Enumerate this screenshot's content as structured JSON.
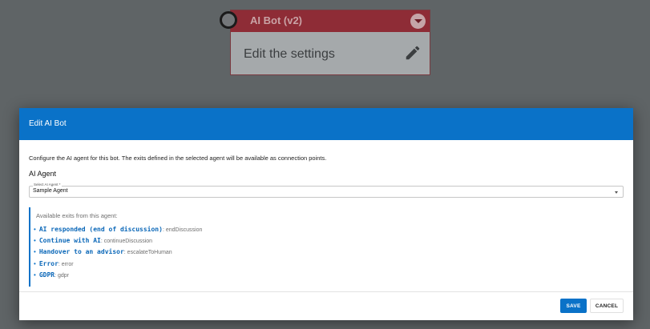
{
  "node": {
    "title": "AI Bot (v2)",
    "body": "Edit the settings",
    "icons": [
      "chevron-down-icon",
      "pencil-icon"
    ]
  },
  "dialog": {
    "title": "Edit AI Bot",
    "description": "Configure the AI agent for this bot. The exits defined in the selected agent will be available as connection points.",
    "agent_heading": "AI Agent",
    "select": {
      "label": "Select AI Agent *",
      "value": "Sample Agent"
    },
    "exits_intro": "Available exits from this agent:",
    "exits": [
      {
        "name": "AI responded (end of discussion)",
        "id": ": endDiscussion"
      },
      {
        "name": "Continue with AI",
        "id": ": continueDiscussion"
      },
      {
        "name": "Handover to an advisor",
        "id": ": escalateToHuman"
      },
      {
        "name": "Error",
        "id": ": error"
      },
      {
        "name": "GDPR",
        "id": ": gdpr"
      }
    ],
    "save_label": "SAVE",
    "cancel_label": "CANCEL"
  },
  "colors": {
    "backdrop": "#5f6466",
    "accent": "#0a72c8",
    "node_header": "#8e2c36"
  }
}
